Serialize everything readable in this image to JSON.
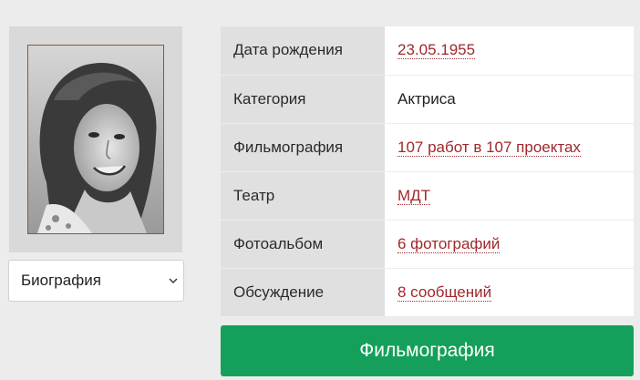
{
  "profile": {
    "photo_icon": "portrait-photo",
    "frame_color": "#8a5a2e"
  },
  "section_select": {
    "selected": "Биография",
    "icon": "chevron-down-icon"
  },
  "info": {
    "rows": [
      {
        "label": "Дата рождения",
        "value": "23.05.1955",
        "link": true
      },
      {
        "label": "Категория",
        "value": "Актриса",
        "link": false
      },
      {
        "label": "Фильмография",
        "value": "107 работ в 107 проектах",
        "link": true
      },
      {
        "label": "Театр",
        "value": "МДТ",
        "link": true
      },
      {
        "label": "Фотоальбом",
        "value": "6 фотографий",
        "link": true
      },
      {
        "label": "Обсуждение",
        "value": "8 сообщений",
        "link": true
      }
    ]
  },
  "filmography_button": {
    "label": "Фильмография"
  },
  "colors": {
    "accent": "#14a05a",
    "link": "#a0282c",
    "label_bg": "#e0e0e0",
    "page_bg": "#ececec"
  }
}
